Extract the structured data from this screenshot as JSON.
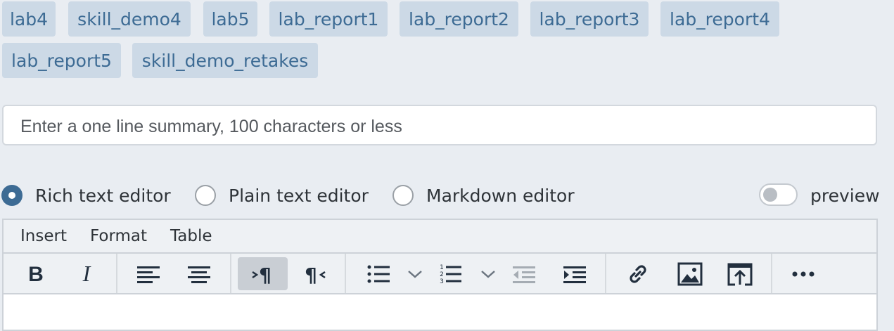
{
  "tags": [
    "lab4",
    "skill_demo4",
    "lab5",
    "lab_report1",
    "lab_report2",
    "lab_report3",
    "lab_report4",
    "lab_report5",
    "skill_demo_retakes"
  ],
  "summary": {
    "placeholder": "Enter a one line summary, 100 characters or less"
  },
  "editor_modes": {
    "rich": "Rich text editor",
    "plain": "Plain text editor",
    "markdown": "Markdown editor",
    "selected": "rich"
  },
  "preview": {
    "label": "preview",
    "enabled": false
  },
  "menubar": {
    "insert": "Insert",
    "format": "Format",
    "table": "Table"
  },
  "toolbar": {
    "icons": [
      "bold-icon",
      "italic-icon",
      "align-left-icon",
      "align-center-icon",
      "ltr-icon",
      "rtl-icon",
      "bullet-list-icon",
      "numbered-list-icon",
      "outdent-icon",
      "indent-icon",
      "link-icon",
      "image-icon",
      "embed-icon",
      "more-icon"
    ],
    "active": "ltr-icon"
  },
  "colors": {
    "accent": "#3d6b94",
    "tag_bg": "#ccd9e6",
    "page_bg": "#e9edf2"
  }
}
